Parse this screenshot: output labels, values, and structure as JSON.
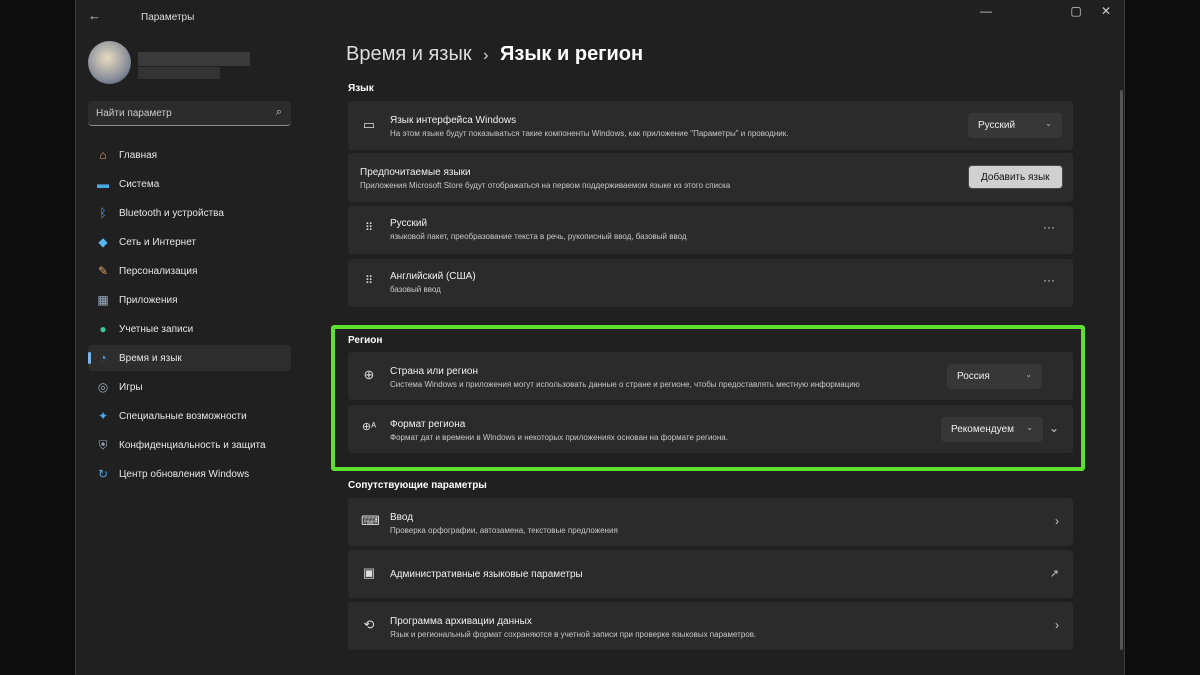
{
  "window": {
    "title": "Параметры"
  },
  "sidebar": {
    "search_placeholder": "Найти параметр",
    "items": [
      {
        "label": "Главная",
        "icon": "home-icon",
        "glyph": "⌂",
        "color": "#e8a070"
      },
      {
        "label": "Система",
        "icon": "system-icon",
        "glyph": "▬",
        "color": "#4aa8e8"
      },
      {
        "label": "Bluetooth и устройства",
        "icon": "bluetooth-icon",
        "glyph": "ᛒ",
        "color": "#4aa8e8"
      },
      {
        "label": "Сеть и Интернет",
        "icon": "wifi-icon",
        "glyph": "◆",
        "color": "#5ab8f0"
      },
      {
        "label": "Персонализация",
        "icon": "brush-icon",
        "glyph": "✎",
        "color": "#e0a060"
      },
      {
        "label": "Приложения",
        "icon": "apps-icon",
        "glyph": "▦",
        "color": "#a0b0c8"
      },
      {
        "label": "Учетные записи",
        "icon": "user-icon",
        "glyph": "●",
        "color": "#3cc8a0"
      },
      {
        "label": "Время и язык",
        "icon": "globe-clock-icon",
        "glyph": "◔",
        "color": "#4aa8e8"
      },
      {
        "label": "Игры",
        "icon": "gamepad-icon",
        "glyph": "◎",
        "color": "#a0a8b8"
      },
      {
        "label": "Специальные возможности",
        "icon": "accessibility-icon",
        "glyph": "✦",
        "color": "#4aa8e8"
      },
      {
        "label": "Конфиденциальность и защита",
        "icon": "shield-icon",
        "glyph": "⛨",
        "color": "#a0a8b8"
      },
      {
        "label": "Центр обновления Windows",
        "icon": "update-icon",
        "glyph": "↻",
        "color": "#4aa8e8"
      }
    ],
    "selected": 7
  },
  "breadcrumb": {
    "parent": "Время и язык",
    "sep": "›",
    "current": "Язык и регион"
  },
  "language": {
    "heading": "Язык",
    "display": {
      "title": "Язык интерфейса Windows",
      "desc": "На этом языке будут показываться такие компоненты Windows, как приложение \"Параметры\" и проводник.",
      "value": "Русский"
    },
    "preferred": {
      "title": "Предпочитаемые языки",
      "desc": "Приложения Microsoft Store будут отображаться на первом поддерживаемом языке из этого списка",
      "button": "Добавить язык"
    },
    "langs": [
      {
        "title": "Русский",
        "desc": "языковой пакет, преобразование текста в речь, рукописный ввод, базовый ввод"
      },
      {
        "title": "Английский (США)",
        "desc": "базовый ввод"
      }
    ]
  },
  "region": {
    "heading": "Регион",
    "country": {
      "title": "Страна или регион",
      "desc": "Система Windows и приложения могут использовать данные о стране и регионе, чтобы предоставлять местную информацию",
      "value": "Россия"
    },
    "format": {
      "title": "Формат региона",
      "desc": "Формат дат и времени в Windows и некоторых приложениях основан на формате региона.",
      "value": "Рекомендуем"
    },
    "highlight_color": "#5ee031"
  },
  "related": {
    "heading": "Сопутствующие параметры",
    "items": [
      {
        "title": "Ввод",
        "desc": "Проверка орфографии, автозамена, текстовые предложения"
      },
      {
        "title": "Административные языковые параметры"
      },
      {
        "title": "Программа архивации данных",
        "desc": "Язык и региональный формат сохраняются в учетной записи при проверке языковых параметров."
      }
    ]
  }
}
